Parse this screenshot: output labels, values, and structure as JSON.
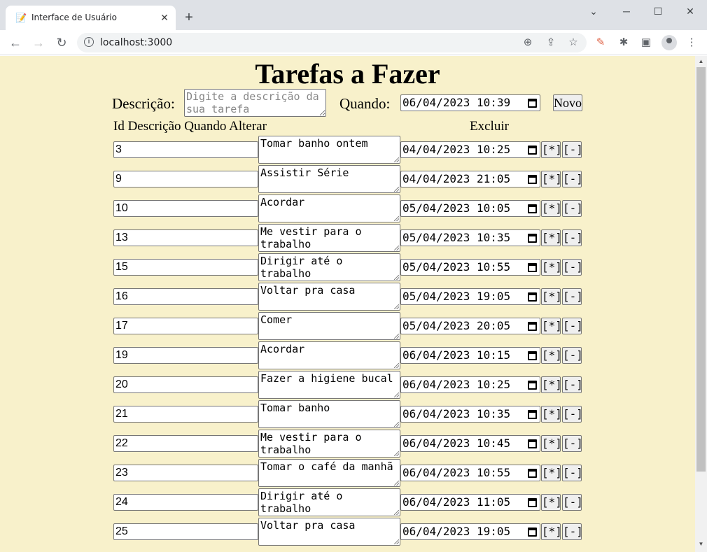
{
  "browser": {
    "tab_title": "Interface de Usuário",
    "url": "localhost:3000"
  },
  "page": {
    "title": "Tarefas a Fazer",
    "form": {
      "description_label": "Descrição:",
      "description_placeholder": "Digite a descrição da sua tarefa",
      "when_label": "Quando:",
      "when_value": "06/04/2023 10:39",
      "new_button": "Novo"
    },
    "table": {
      "headers": [
        "Id Descrição Quando Alterar",
        "Excluir"
      ],
      "edit_button": "[*]",
      "delete_button": "[-]",
      "rows": [
        {
          "id": "3",
          "description": "Tomar banho ontem",
          "when": "04/04/2023 10:25"
        },
        {
          "id": "9",
          "description": "Assistir Série",
          "when": "04/04/2023 21:05"
        },
        {
          "id": "10",
          "description": "Acordar",
          "when": "05/04/2023 10:05"
        },
        {
          "id": "13",
          "description": "Me vestir para o trabalho",
          "when": "05/04/2023 10:35"
        },
        {
          "id": "15",
          "description": "Dirigir até o trabalho",
          "when": "05/04/2023 10:55"
        },
        {
          "id": "16",
          "description": "Voltar pra casa",
          "when": "05/04/2023 19:05"
        },
        {
          "id": "17",
          "description": "Comer",
          "when": "05/04/2023 20:05"
        },
        {
          "id": "19",
          "description": "Acordar",
          "when": "06/04/2023 10:15"
        },
        {
          "id": "20",
          "description": "Fazer a higiene bucal",
          "when": "06/04/2023 10:25"
        },
        {
          "id": "21",
          "description": "Tomar banho",
          "when": "06/04/2023 10:35"
        },
        {
          "id": "22",
          "description": "Me vestir para o trabalho",
          "when": "06/04/2023 10:45"
        },
        {
          "id": "23",
          "description": "Tomar o café da manhã",
          "when": "06/04/2023 10:55"
        },
        {
          "id": "24",
          "description": "Dirigir até o trabalho",
          "when": "06/04/2023 11:05"
        },
        {
          "id": "25",
          "description": "Voltar pra casa",
          "when": "06/04/2023 19:05"
        }
      ]
    }
  }
}
